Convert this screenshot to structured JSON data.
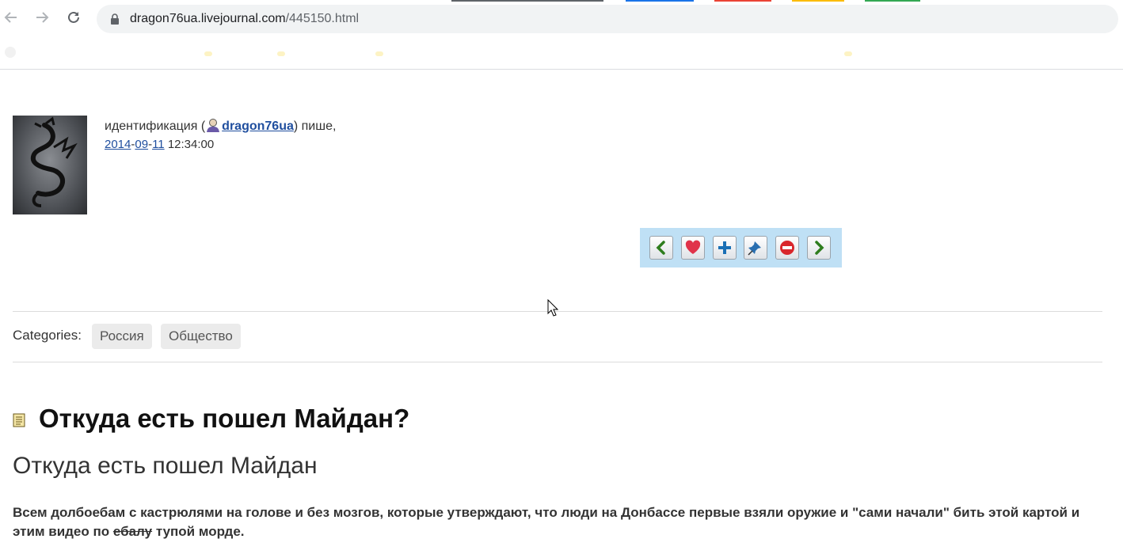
{
  "browser": {
    "url_host": "dragon76ua.livejournal.com",
    "url_path": "/445150.html",
    "icons": {
      "back": "back-arrow-icon",
      "forward": "forward-arrow-icon",
      "reload": "reload-icon",
      "secure": "lock-icon"
    }
  },
  "post_header": {
    "by_prefix": "идентификация (",
    "username": "dragon76ua",
    "by_suffix": ") пише,",
    "date_year": "2014",
    "date_month": "09",
    "date_day": "11",
    "date_sep": "-",
    "time": "12:34:00"
  },
  "actions": {
    "icons": [
      "previous-arrow-icon",
      "heart-icon",
      "plus-icon",
      "pin-icon",
      "stop-icon",
      "next-arrow-icon"
    ]
  },
  "categories": {
    "label": "Categories:",
    "tags": [
      "Россия",
      "Общество"
    ]
  },
  "post": {
    "title": "Откуда есть пошел Майдан?",
    "subtitle": "Откуда есть пошел Майдан",
    "paragraph_part1": "Всем долбоебам с кастрюлями на голове и без мозгов, которые утверждают, что люди на Донбассе первые взяли оружие и \"сами начали\" бить этой картой и этим видео по ",
    "paragraph_struck": "ебалу",
    "paragraph_part2": " тупой морде."
  },
  "colors": {
    "link": "#1f4e9e",
    "action_bar_bg": "#bfe0f5",
    "tag_bg": "#ebebeb"
  }
}
